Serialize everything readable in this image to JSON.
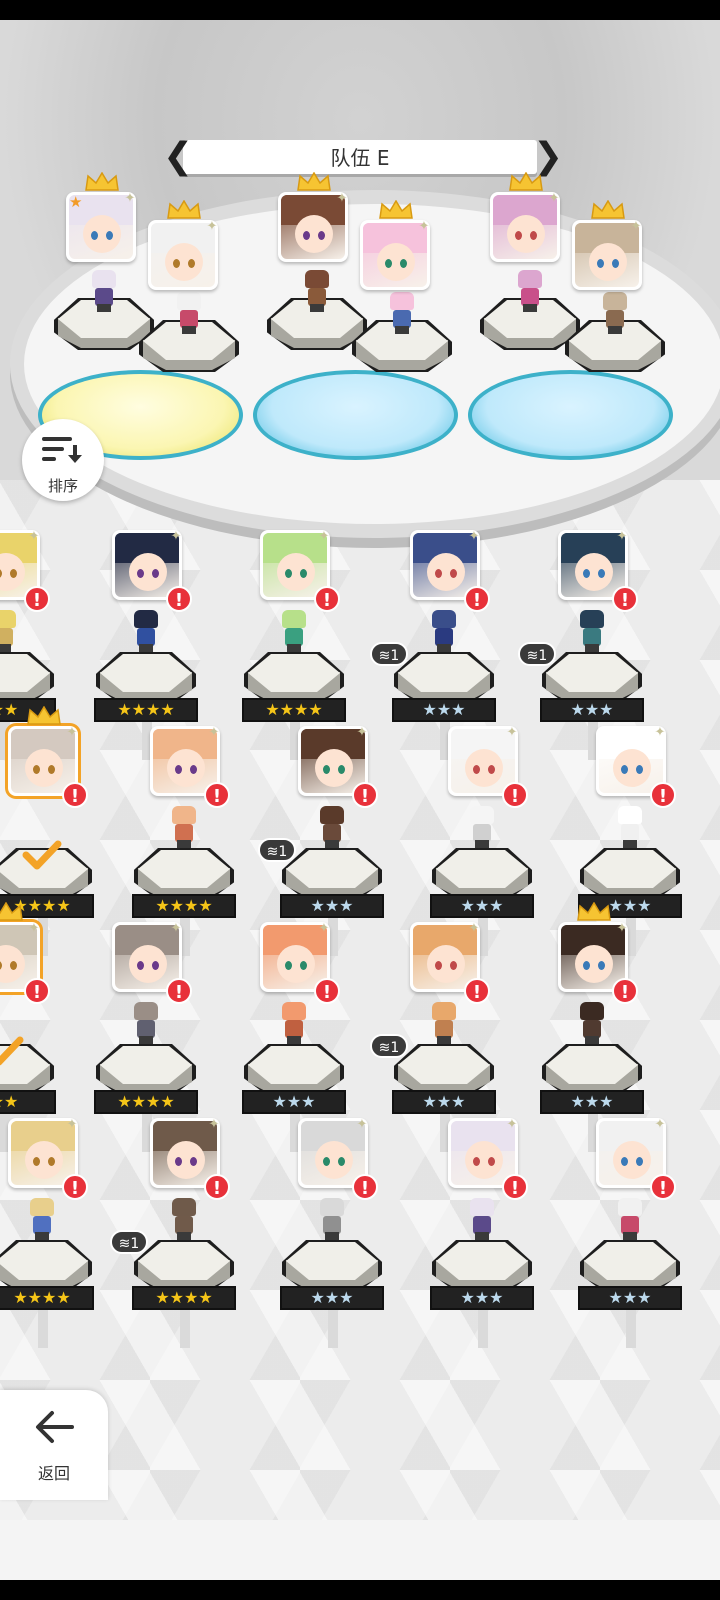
{
  "team": {
    "title": "队伍 E"
  },
  "sort": {
    "label": "排序"
  },
  "back": {
    "label": "返回"
  },
  "colors": {
    "gold_star": "#f5c518",
    "blue_star": "#bcd9ec",
    "alert": "#e8313a",
    "selected_border": "#f3a327"
  },
  "stars": {
    "four": "★★★★",
    "three": "★★★",
    "two": "★★"
  },
  "alert_mark": "!",
  "dupe_label": "1",
  "roster": [
    {
      "row": 1,
      "items": [
        {
          "col": 0,
          "stars": "two",
          "alert": true
        },
        {
          "col": 1,
          "stars": "four",
          "alert": true
        },
        {
          "col": 2,
          "stars": "four",
          "alert": true
        },
        {
          "col": 3,
          "stars": "three",
          "alert": true,
          "dupe": true
        },
        {
          "col": 4,
          "stars": "three",
          "alert": true,
          "dupe": true
        }
      ]
    },
    {
      "row": 2,
      "items": [
        {
          "col": 0,
          "stars": "four",
          "selected": true,
          "crown": true,
          "alert": true
        },
        {
          "col": 1,
          "stars": "four",
          "alert": true
        },
        {
          "col": 2,
          "stars": "three",
          "alert": true,
          "dupe": true
        },
        {
          "col": 3,
          "stars": "three",
          "alert": true
        },
        {
          "col": 4,
          "stars": "three",
          "alert": true
        }
      ]
    },
    {
      "row": 3,
      "items": [
        {
          "col": 0,
          "stars": "two",
          "selected": true,
          "crown": true,
          "alert": true
        },
        {
          "col": 1,
          "stars": "four",
          "alert": true
        },
        {
          "col": 2,
          "stars": "three",
          "alert": true
        },
        {
          "col": 3,
          "stars": "three",
          "alert": true,
          "dupe": true
        },
        {
          "col": 4,
          "stars": "three",
          "alert": true,
          "crown": true
        }
      ]
    },
    {
      "row": 4,
      "items": [
        {
          "col": 0,
          "stars": "four",
          "alert": true
        },
        {
          "col": 1,
          "stars": "four",
          "alert": true,
          "dupe": true
        },
        {
          "col": 2,
          "stars": "three",
          "alert": true
        },
        {
          "col": 3,
          "stars": "three",
          "alert": true
        },
        {
          "col": 4,
          "stars": "three",
          "alert": true
        }
      ]
    }
  ]
}
